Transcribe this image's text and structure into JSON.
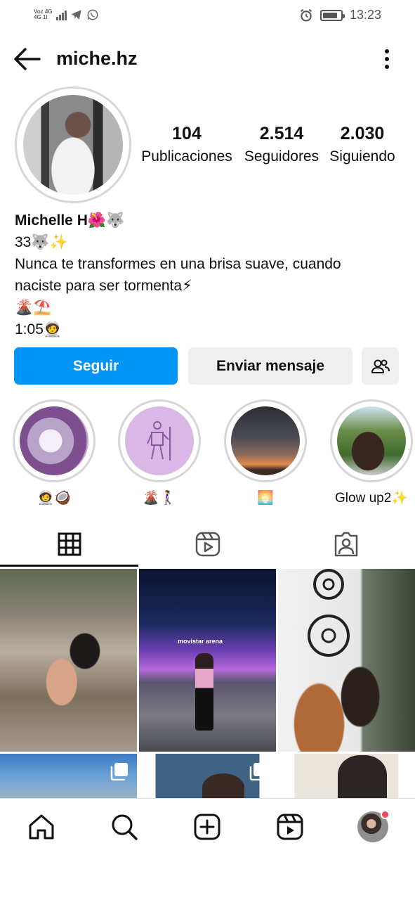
{
  "status_bar": {
    "network_line1": "Voz 4G",
    "network_line2": "4G 1l",
    "time": "13:23"
  },
  "header": {
    "username": "miche.hz"
  },
  "profile": {
    "stats": [
      {
        "value": "104",
        "label": "Publicaciones"
      },
      {
        "value": "2.514",
        "label": "Seguidores"
      },
      {
        "value": "2.030",
        "label": "Siguiendo"
      }
    ],
    "name": "Michelle H🌺🐺",
    "bio_lines": [
      "33🐺✨",
      "Nunca te transformes en una brisa suave, cuando naciste para ser tormenta⚡",
      "🌋⛱️",
      "1:05🧑‍🚀"
    ]
  },
  "buttons": {
    "follow": "Seguir",
    "message": "Enviar mensaje"
  },
  "highlights": [
    {
      "label": "🧑‍🚀🥥"
    },
    {
      "label": "🌋🚶‍♀️"
    },
    {
      "label": "🌅"
    },
    {
      "label": "Glow up2✨"
    }
  ],
  "tabs": [
    {
      "icon": "grid-icon"
    },
    {
      "icon": "reels-icon"
    },
    {
      "icon": "tagged-icon"
    }
  ],
  "posts": [
    {
      "index": 1,
      "multi": false
    },
    {
      "index": 2,
      "multi": false,
      "sign_text": "movistar arena"
    },
    {
      "index": 3,
      "multi": false
    },
    {
      "index": 4,
      "multi": true
    },
    {
      "index": 5,
      "multi": true
    },
    {
      "index": 6,
      "multi": false
    }
  ],
  "colors": {
    "accent": "#0095f6",
    "button_gray": "#efefef",
    "notification": "#ed4956"
  }
}
